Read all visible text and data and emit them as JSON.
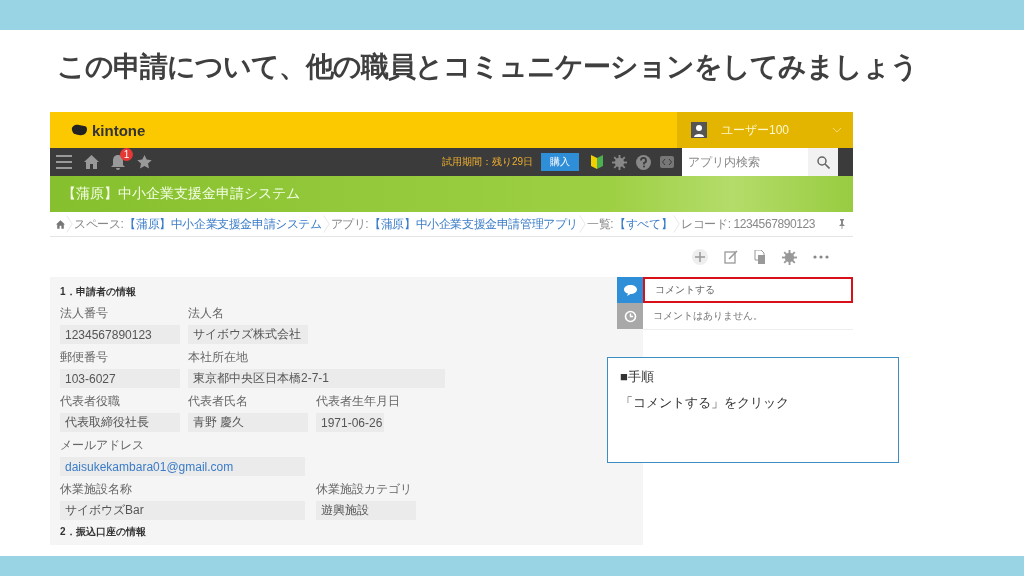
{
  "slide": {
    "title": "この申請について、他の職員とコミュニケーションをしてみましょう"
  },
  "header": {
    "logo": "kintone",
    "user": "ユーザー100",
    "notification_badge": "1",
    "trial": "試用期間：残り29日",
    "buy_button": "購入",
    "search": {
      "placeholder": "アプリ内検索"
    }
  },
  "app_title": "【蒲原】中小企業支援金申請システム",
  "breadcrumbs": [
    {
      "label": "スペース:",
      "link": "【蒲原】中小企業支援金申請システム"
    },
    {
      "label": "アプリ:",
      "link": "【蒲原】中小企業支援金申請管理アプリ"
    },
    {
      "label": "一覧:",
      "link": "【すべて】"
    },
    {
      "label": "レコード: 1234567890123"
    }
  ],
  "form": {
    "sections": [
      {
        "title": "1．申請者の情報",
        "rows": [
          [
            {
              "label": "法人番号",
              "value": "1234567890123",
              "kind": "text"
            },
            {
              "label": "法人名",
              "value": "サイボウズ株式会社",
              "kind": "text"
            }
          ],
          [
            {
              "label": "郵便番号",
              "value": "103-6027",
              "kind": "text"
            },
            {
              "label": "本社所在地",
              "value": "東京都中央区日本橋2-7-1",
              "kind": "text"
            }
          ],
          [
            {
              "label": "代表者役職",
              "value": "代表取締役社長",
              "kind": "text"
            },
            {
              "label": "代表者氏名",
              "value": "青野 慶久",
              "kind": "text"
            },
            {
              "label": "代表者生年月日",
              "value": "1971-06-26",
              "kind": "text"
            }
          ],
          [
            {
              "label": "メールアドレス",
              "value": "daisukekambara01@gmail.com",
              "kind": "link"
            }
          ],
          [
            {
              "label": "休業施設名称",
              "value": "サイボウズBar",
              "kind": "text"
            },
            "",
            {
              "label": "休業施設カテゴリ",
              "value": "遊興施設",
              "kind": "text"
            }
          ]
        ]
      },
      {
        "title": "2．振込口座の情報"
      }
    ]
  },
  "comments": {
    "tabs": [
      {
        "kind": "comment",
        "selected": true
      },
      {
        "kind": "history",
        "selected": false
      }
    ],
    "input": {
      "placeholder": "コメントする",
      "highlighted": true
    },
    "empty_text": "コメントはありません。"
  },
  "callout": {
    "heading": "■手順",
    "body": "「コメントする」をクリック"
  }
}
